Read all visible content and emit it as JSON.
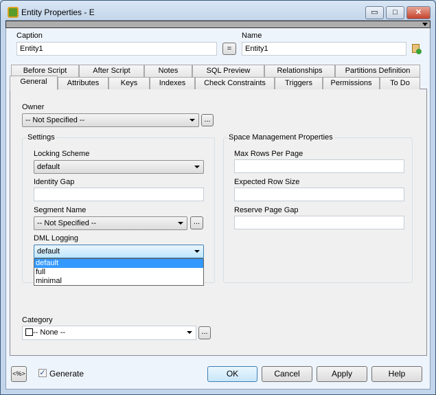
{
  "window": {
    "title": "Entity Properties - E",
    "minimize": "▭",
    "maximize": "□",
    "close": "✕"
  },
  "header": {
    "caption_label": "Caption",
    "caption_value": "Entity1",
    "equals_button": "=",
    "name_label": "Name",
    "name_value": "Entity1"
  },
  "tabs_row1": [
    "Before Script",
    "After Script",
    "Notes",
    "SQL Preview",
    "Relationships",
    "Partitions Definition"
  ],
  "tabs_row2": [
    "General",
    "Attributes",
    "Keys",
    "Indexes",
    "Check Constraints",
    "Triggers",
    "Permissions",
    "To Do"
  ],
  "general": {
    "owner_label": "Owner",
    "owner_value": "-- Not Specified --",
    "browse": "...",
    "settings_title": "Settings",
    "locking_label": "Locking Scheme",
    "locking_value": "default",
    "identity_label": "Identity Gap",
    "identity_value": "",
    "segment_label": "Segment Name",
    "segment_value": "-- Not Specified --",
    "dml_label": "DML Logging",
    "dml_value": "default",
    "dml_options": [
      "default",
      "full",
      "minimal"
    ],
    "space_title": "Space Management Properties",
    "max_rows_label": "Max Rows Per Page",
    "max_rows_value": "",
    "row_size_label": "Expected Row Size",
    "row_size_value": "",
    "reserve_label": "Reserve Page Gap",
    "reserve_value": "",
    "category_label": "Category",
    "category_value": "-- None --"
  },
  "footer": {
    "macro_button": "<%>",
    "generate_label": "Generate",
    "generate_checked": true,
    "ok": "OK",
    "cancel": "Cancel",
    "apply": "Apply",
    "help": "Help"
  },
  "colors": {
    "selection": "#3399ff",
    "focus": "#3c7fb1"
  }
}
